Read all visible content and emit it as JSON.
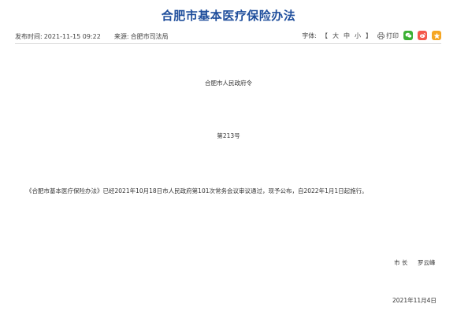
{
  "article": {
    "title": "合肥市基本医疗保险办法",
    "publish_label": "发布时间:",
    "publish_time": "2021-11-15 09:22",
    "source_label": "来源:",
    "source": "合肥市司法局"
  },
  "toolbar": {
    "font_label": "字体:",
    "bracket_open": "【",
    "size_large": "大",
    "size_medium": "中",
    "size_small": "小",
    "bracket_close": "】",
    "print_label": "打印",
    "share_icons": [
      "wechat-icon",
      "weibo-icon",
      "qzone-icon"
    ],
    "colors": {
      "wechat": "#3cb034",
      "weibo": "#f4584a",
      "qzone": "#f5a623"
    }
  },
  "body": {
    "issuer": "合肥市人民政府令",
    "order_no": "第213号",
    "paragraph": "《合肥市基本医疗保险办法》已经2021年10月18日市人民政府第101次常务会议审议通过，现予公布，自2022年1月1日起施行。",
    "signer_title": "市  长",
    "signer_name": "罗云峰",
    "date": "2021年11月4日"
  },
  "colors": {
    "title": "#1f4e9c"
  }
}
